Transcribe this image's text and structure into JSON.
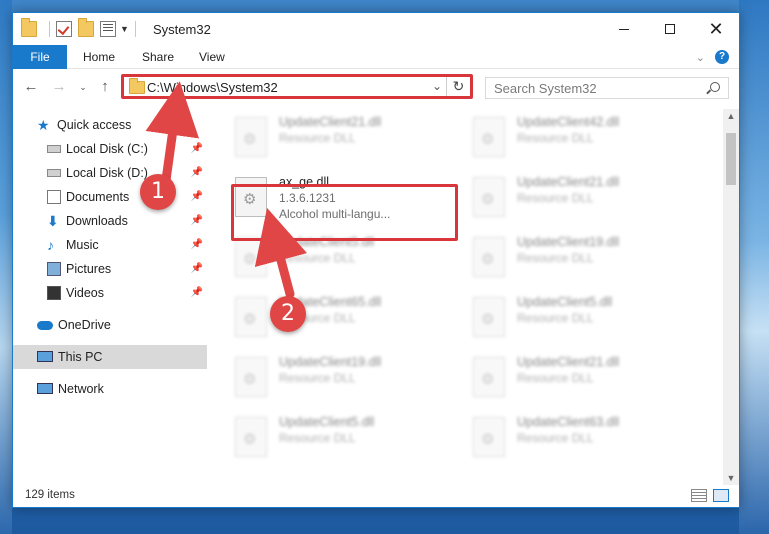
{
  "window": {
    "title": "System32"
  },
  "ribbon": {
    "tabs": [
      "File",
      "Home",
      "Share",
      "View"
    ]
  },
  "address": {
    "path": "C:\\Windows\\System32"
  },
  "search": {
    "placeholder": "Search System32"
  },
  "sidebar": {
    "items": [
      {
        "label": "Quick access",
        "icon": "star-icon"
      },
      {
        "label": "Local Disk (C:)",
        "icon": "drive-icon",
        "pinned": true
      },
      {
        "label": "Local Disk (D:)",
        "icon": "drive-icon",
        "pinned": true
      },
      {
        "label": "Documents",
        "icon": "documents-icon",
        "pinned": true
      },
      {
        "label": "Downloads",
        "icon": "download-icon",
        "pinned": true
      },
      {
        "label": "Music",
        "icon": "music-icon",
        "pinned": true
      },
      {
        "label": "Pictures",
        "icon": "pictures-icon",
        "pinned": true
      },
      {
        "label": "Videos",
        "icon": "videos-icon",
        "pinned": true
      },
      {
        "label": "OneDrive",
        "icon": "cloud-icon"
      },
      {
        "label": "This PC",
        "icon": "computer-icon",
        "selected": true
      },
      {
        "label": "Network",
        "icon": "network-icon"
      }
    ]
  },
  "files": {
    "left": [
      {
        "name": "UpdateClient21.dll",
        "type": "Resource DLL"
      },
      {
        "name": "ax_ge.dll",
        "version": "1.3.6.1231",
        "description": "Alcohol multi-langu..."
      },
      {
        "name": "UpdateClient5.dll",
        "type": "Resource DLL"
      },
      {
        "name": "UpdateClient65.dll",
        "type": "Resource DLL"
      },
      {
        "name": "UpdateClient19.dll",
        "type": "Resource DLL"
      },
      {
        "name": "UpdateClient5.dll",
        "type": "Resource DLL"
      }
    ],
    "right": [
      {
        "name": "UpdateClient42.dll",
        "type": "Resource DLL"
      },
      {
        "name": "UpdateClient21.dll",
        "type": "Resource DLL"
      },
      {
        "name": "UpdateClient19.dll",
        "type": "Resource DLL"
      },
      {
        "name": "UpdateClient5.dll",
        "type": "Resource DLL"
      },
      {
        "name": "UpdateClient21.dll",
        "type": "Resource DLL"
      },
      {
        "name": "UpdateClient63.dll",
        "type": "Resource DLL"
      }
    ]
  },
  "status": {
    "item_count": "129 items"
  },
  "annotations": {
    "step1": "1",
    "step2": "2",
    "highlight_color": "#d9363c"
  }
}
